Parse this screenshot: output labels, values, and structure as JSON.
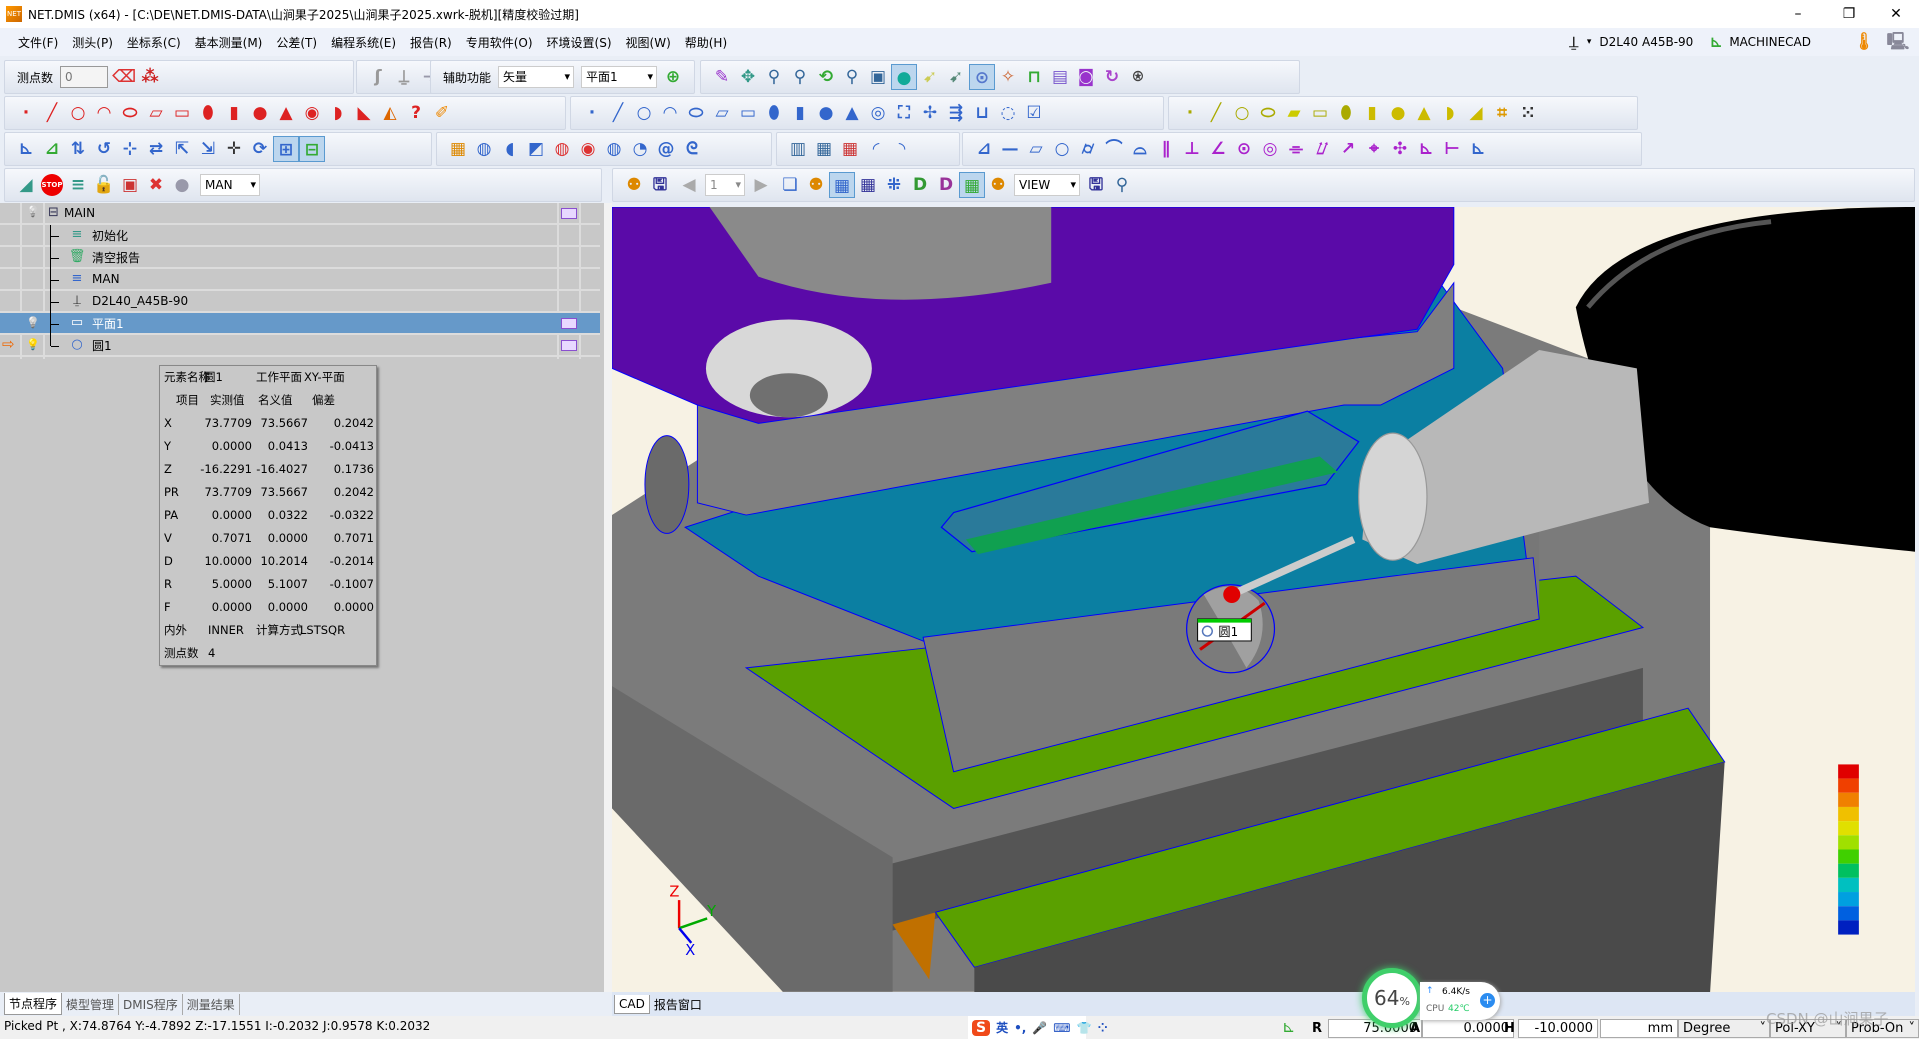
{
  "window": {
    "title": "NET.DMIS (x64) - [C:\\DE\\NET.DMIS-DATA\\山涧果子2025\\山涧果子2025.xwrk-脱机][精度校验过期]",
    "logo_text": "NET",
    "controls": {
      "minimize": "–",
      "restore": "❐",
      "close": "✕"
    }
  },
  "menu": [
    "文件(F)",
    "测头(P)",
    "坐标系(C)",
    "基本测量(M)",
    "公差(T)",
    "编程系统(E)",
    "报告(R)",
    "专用软件(O)",
    "环境设置(S)",
    "视图(W)",
    "帮助(H)"
  ],
  "menu_right": {
    "probe": "D2L40  A45B-90",
    "machine": "MACHINECAD"
  },
  "toolbar1": {
    "points_label": "测点数",
    "points_value": "0",
    "aux_label": "辅助功能",
    "vector_select": "矢量",
    "plane_select": "平面1",
    "icons_a": [
      {
        "n": "eraser-icon",
        "g": "⌫",
        "c": "#d33"
      },
      {
        "n": "erase-all-icon",
        "g": "⁂",
        "c": "#c22"
      }
    ],
    "icons_b": [
      {
        "n": "run-icon",
        "g": "ʃ",
        "c": "#999"
      },
      {
        "n": "joystick-icon",
        "g": "⍊",
        "c": "#999"
      },
      {
        "n": "arrow-right-icon",
        "g": "➔",
        "c": "#99a"
      },
      {
        "n": "xyz-plane-icon",
        "g": "◇",
        "c": "#36c"
      },
      {
        "n": "report-icon",
        "g": "▤",
        "c": "#557"
      },
      {
        "n": "home-icon",
        "g": "⌂",
        "c": "#e80"
      },
      {
        "n": "warning-icon",
        "g": "⚠",
        "c": "#cc0"
      }
    ],
    "icons_c": [
      {
        "n": "lock-plane-icon",
        "g": "⊕",
        "c": "#3a3"
      }
    ],
    "icons_d": [
      {
        "n": "clean-icon",
        "g": "✎",
        "c": "#93c"
      },
      {
        "n": "move-icon",
        "g": "✥",
        "c": "#398"
      },
      {
        "n": "zoom-window-icon",
        "g": "⚲",
        "c": "#369"
      },
      {
        "n": "zoom-plus-icon",
        "g": "⚲",
        "c": "#369"
      },
      {
        "n": "rotate-icon",
        "g": "⟲",
        "c": "#3a3"
      },
      {
        "n": "zoom-in-icon",
        "g": "⚲",
        "c": "#369"
      },
      {
        "n": "cube-view-icon",
        "g": "▣",
        "c": "#369"
      },
      {
        "n": "shade-icon",
        "g": "●",
        "c": "#1a9",
        "on": true
      },
      {
        "n": "select-icon",
        "g": "➹",
        "c": "#cc5"
      },
      {
        "n": "pick-icon",
        "g": "➹",
        "c": "#587"
      },
      {
        "n": "mouse-icon",
        "g": "⊙",
        "c": "#57c",
        "on": true
      },
      {
        "n": "spark-icon",
        "g": "✧",
        "c": "#c63"
      },
      {
        "n": "frame-icon",
        "g": "⊓",
        "c": "#3a3"
      },
      {
        "n": "list-icon",
        "g": "▤",
        "c": "#75c"
      },
      {
        "n": "camera-icon",
        "g": "◙",
        "c": "#93c"
      },
      {
        "n": "refresh-icon",
        "g": "↻",
        "c": "#a4c"
      },
      {
        "n": "probe-on-icon",
        "g": "⍟",
        "c": "#444"
      }
    ]
  },
  "toolbar2": {
    "icons_a": [
      {
        "n": "point-icon",
        "g": "·",
        "c": "#d22"
      },
      {
        "n": "line-icon",
        "g": "╱",
        "c": "#d22"
      },
      {
        "n": "circle-icon",
        "g": "○",
        "c": "#d22"
      },
      {
        "n": "arc-icon",
        "g": "◠",
        "c": "#d22"
      },
      {
        "n": "ellipse-icon",
        "g": "⬭",
        "c": "#d22"
      },
      {
        "n": "slot-icon",
        "g": "▱",
        "c": "#d22"
      },
      {
        "n": "rectangle-icon",
        "g": "▭",
        "c": "#d22"
      },
      {
        "n": "rounded-slot-icon",
        "g": "⬮",
        "c": "#d22"
      },
      {
        "n": "cylinder-icon",
        "g": "▮",
        "c": "#d22"
      },
      {
        "n": "sphere-icon",
        "g": "●",
        "c": "#d22"
      },
      {
        "n": "cone-icon",
        "g": "▲",
        "c": "#d22"
      },
      {
        "n": "torus-icon",
        "g": "◉",
        "c": "#d22"
      },
      {
        "n": "curve-icon",
        "g": "◗",
        "c": "#d22"
      },
      {
        "n": "edge-icon",
        "g": "◣",
        "c": "#d22"
      },
      {
        "n": "angle-icon",
        "g": "◭",
        "c": "#d60"
      },
      {
        "n": "help-icon",
        "g": "?",
        "c": "#d22"
      },
      {
        "n": "path-icon",
        "g": "✐",
        "c": "#e80"
      }
    ],
    "icons_b": [
      {
        "n": "point-blue-icon",
        "g": "·",
        "c": "#36c"
      },
      {
        "n": "line-blue-icon",
        "g": "╱",
        "c": "#36c"
      },
      {
        "n": "circle-blue-icon",
        "g": "○",
        "c": "#36c"
      },
      {
        "n": "arc-blue-icon",
        "g": "◠",
        "c": "#36c"
      },
      {
        "n": "ellipse-blue-icon",
        "g": "⬭",
        "c": "#36c"
      },
      {
        "n": "plane-blue-icon",
        "g": "▱",
        "c": "#36c"
      },
      {
        "n": "rect-blue-icon",
        "g": "▭",
        "c": "#36c"
      },
      {
        "n": "slot-blue-icon",
        "g": "⬮",
        "c": "#36c"
      },
      {
        "n": "cylinder-blue-icon",
        "g": "▮",
        "c": "#36c"
      },
      {
        "n": "sphere-blue-icon",
        "g": "●",
        "c": "#36c"
      },
      {
        "n": "cone-blue-icon",
        "g": "▲",
        "c": "#36c"
      },
      {
        "n": "torus-blue-icon",
        "g": "◎",
        "c": "#36c"
      },
      {
        "n": "box-blue-icon",
        "g": "⛶",
        "c": "#36c"
      },
      {
        "n": "tools-icon",
        "g": "✢",
        "c": "#36c"
      },
      {
        "n": "arrows-icon",
        "g": "⇶",
        "c": "#36c"
      },
      {
        "n": "corner-icon",
        "g": "⊔",
        "c": "#36c"
      },
      {
        "n": "dashed-circle-icon",
        "g": "◌",
        "c": "#36c"
      },
      {
        "n": "check-icon",
        "g": "☑",
        "c": "#36c"
      }
    ],
    "icons_c": [
      {
        "n": "point-yellow-icon",
        "g": "·",
        "c": "#aa0"
      },
      {
        "n": "line-yellow-icon",
        "g": "╱",
        "c": "#aa0"
      },
      {
        "n": "circle-yellow-icon",
        "g": "○",
        "c": "#aa0"
      },
      {
        "n": "ellipse-yellow-icon",
        "g": "⬭",
        "c": "#aa0"
      },
      {
        "n": "plane-yellow-icon",
        "g": "▰",
        "c": "#cc0"
      },
      {
        "n": "rect-yellow-icon",
        "g": "▭",
        "c": "#aa0"
      },
      {
        "n": "slot-yellow-icon",
        "g": "⬮",
        "c": "#aa0"
      },
      {
        "n": "cylinder-yellow-icon",
        "g": "▮",
        "c": "#cb0"
      },
      {
        "n": "sphere-yellow-icon",
        "g": "●",
        "c": "#cb0"
      },
      {
        "n": "cone-yellow-icon",
        "g": "▲",
        "c": "#cb0"
      },
      {
        "n": "curve-yellow-icon",
        "g": "◗",
        "c": "#cb0"
      },
      {
        "n": "surface-yellow-icon",
        "g": "◢",
        "c": "#cb0"
      },
      {
        "n": "grid-yellow-icon",
        "g": "⌗",
        "c": "#d90"
      },
      {
        "n": "dots-icon",
        "g": "⁙",
        "c": "#333"
      }
    ]
  },
  "toolbar3": {
    "icons_a": [
      {
        "n": "init-coord-icon",
        "g": "⊾",
        "c": "#36c"
      },
      {
        "n": "align-icon",
        "g": "⊿",
        "c": "#3a3"
      },
      {
        "n": "coord-321-icon",
        "g": "⇅",
        "c": "#36c"
      },
      {
        "n": "rotate-coord-icon",
        "g": "↺",
        "c": "#36c"
      },
      {
        "n": "rps-icon",
        "g": "⊹",
        "c": "#36c"
      },
      {
        "n": "best-fit-icon",
        "g": "⇄",
        "c": "#36c"
      },
      {
        "n": "translate-icon",
        "g": "⇱",
        "c": "#36c"
      },
      {
        "n": "transform-icon",
        "g": "⇲",
        "c": "#36c"
      },
      {
        "n": "axis-icon",
        "g": "✛",
        "c": "#333"
      },
      {
        "n": "rotate-axis-icon",
        "g": "⟳",
        "c": "#36c"
      },
      {
        "n": "coord-save-icon",
        "g": "⊞",
        "c": "#36c",
        "on": true
      },
      {
        "n": "coord-recall-icon",
        "g": "⊟",
        "c": "#3a3",
        "on": true
      }
    ],
    "icons_b": [
      {
        "n": "construct-icon",
        "g": "▦",
        "c": "#d80"
      },
      {
        "n": "cylinder-section-icon",
        "g": "◍",
        "c": "#36c"
      },
      {
        "n": "half-cyl-icon",
        "g": "◖",
        "c": "#36c"
      },
      {
        "n": "cut-icon",
        "g": "◩",
        "c": "#36c"
      },
      {
        "n": "cyl-red-icon",
        "g": "◍",
        "c": "#d33"
      },
      {
        "n": "disk-icon",
        "g": "◉",
        "c": "#d33"
      },
      {
        "n": "stack-icon",
        "g": "◍",
        "c": "#36c"
      },
      {
        "n": "fan-icon",
        "g": "◔",
        "c": "#36c"
      },
      {
        "n": "spiral-icon",
        "g": "@",
        "c": "#36c"
      },
      {
        "n": "swirl-icon",
        "g": "ᘓ",
        "c": "#36c"
      }
    ],
    "icons_c": [
      {
        "n": "report-table-icon",
        "g": "▥",
        "c": "#369"
      },
      {
        "n": "grid-table-icon",
        "g": "▦",
        "c": "#369"
      },
      {
        "n": "grid-red-icon",
        "g": "▦",
        "c": "#c33"
      },
      {
        "n": "curve-report-icon",
        "g": "◜",
        "c": "#36c"
      },
      {
        "n": "curve-edit-icon",
        "g": "◝",
        "c": "#36c"
      }
    ],
    "icons_d": [
      {
        "n": "dimension-icon",
        "g": "⊿",
        "c": "#36c"
      },
      {
        "n": "straightness-icon",
        "g": "—",
        "c": "#36c"
      },
      {
        "n": "flatness-icon",
        "g": "▱",
        "c": "#36c"
      },
      {
        "n": "roundness-icon",
        "g": "○",
        "c": "#36c"
      },
      {
        "n": "cylindricity-icon",
        "g": "⌭",
        "c": "#36c"
      },
      {
        "n": "line-profile-icon",
        "g": "⌒",
        "c": "#36c"
      },
      {
        "n": "surface-profile-icon",
        "g": "⌓",
        "c": "#36c"
      },
      {
        "n": "parallelism-icon",
        "g": "∥",
        "c": "#a2c"
      },
      {
        "n": "perpendicularity-icon",
        "g": "⊥",
        "c": "#a2c"
      },
      {
        "n": "angularity-icon",
        "g": "∠",
        "c": "#a2c"
      },
      {
        "n": "concentricity-icon",
        "g": "⊙",
        "c": "#a2c"
      },
      {
        "n": "coaxiality-icon",
        "g": "◎",
        "c": "#a2c"
      },
      {
        "n": "symmetry-icon",
        "g": "⌯",
        "c": "#a2c"
      },
      {
        "n": "total-runout-icon",
        "g": "⌰",
        "c": "#a2c"
      },
      {
        "n": "runout-icon",
        "g": "↗",
        "c": "#a2c"
      },
      {
        "n": "position-icon",
        "g": "⌖",
        "c": "#a2c"
      },
      {
        "n": "position-multi-icon",
        "g": "✣",
        "c": "#a2c"
      },
      {
        "n": "distance-icon",
        "g": "⊾",
        "c": "#a2c"
      },
      {
        "n": "width-icon",
        "g": "⊢",
        "c": "#a2c"
      },
      {
        "n": "chart-icon",
        "g": "⊾",
        "c": "#36c"
      }
    ]
  },
  "tree_toolbar": {
    "mode_select": "MAN",
    "icons": [
      {
        "n": "curve-run-icon",
        "g": "◢",
        "c": "#398"
      },
      {
        "n": "stop-icon",
        "g": "STOP",
        "c": "#fff"
      },
      {
        "n": "program-icon",
        "g": "≡",
        "c": "#398"
      },
      {
        "n": "unlock-icon",
        "g": "🔓",
        "c": "#eb0"
      },
      {
        "n": "window-ball-icon",
        "g": "▣",
        "c": "#c33"
      },
      {
        "n": "delete-balls-icon",
        "g": "✖",
        "c": "#d33"
      },
      {
        "n": "ball-down-icon",
        "g": "●",
        "c": "#99a"
      }
    ]
  },
  "viewport_toolbar": {
    "page_select": "1",
    "view_select": "VIEW",
    "icons_a": [
      {
        "n": "probe-view-icon",
        "g": "⚉",
        "c": "#d80"
      },
      {
        "n": "save-doc-icon",
        "g": "🖫",
        "c": "#339"
      }
    ],
    "icons_b": [
      {
        "n": "new-page-icon",
        "g": "❏",
        "c": "#36c"
      },
      {
        "n": "probe-page-icon",
        "g": "⚉",
        "c": "#d80"
      },
      {
        "n": "table-view-icon",
        "g": "▦",
        "c": "#36c",
        "on": true
      },
      {
        "n": "table-pick-icon",
        "g": "▦",
        "c": "#339"
      },
      {
        "n": "layout-icon",
        "g": "⁜",
        "c": "#36c"
      },
      {
        "n": "dmis-icon",
        "g": "D",
        "c": "#393"
      },
      {
        "n": "dmis-pick-icon",
        "g": "D",
        "c": "#939"
      },
      {
        "n": "green-table-icon",
        "g": "▦",
        "c": "#3a3",
        "on": true
      },
      {
        "n": "probe-table-icon",
        "g": "⚉",
        "c": "#d80"
      }
    ],
    "icons_c": [
      {
        "n": "save-view-icon",
        "g": "🖫",
        "c": "#339"
      },
      {
        "n": "find-icon",
        "g": "⚲",
        "c": "#369"
      }
    ]
  },
  "tree": {
    "rows": [
      {
        "label": "MAIN",
        "icon": "collapse-icon",
        "glyph": "⊟",
        "color": "#335"
      },
      {
        "label": "初始化",
        "icon": "init-icon",
        "glyph": "≡",
        "color": "#398"
      },
      {
        "label": "清空报告",
        "icon": "clear-report-icon",
        "glyph": "🗑",
        "color": "#3a6"
      },
      {
        "label": "MAN",
        "icon": "mode-icon",
        "glyph": "≡",
        "color": "#36c"
      },
      {
        "label": "D2L40_A45B-90",
        "icon": "probe-icon",
        "glyph": "⍊",
        "color": "#222"
      },
      {
        "label": "平面1",
        "icon": "plane-icon",
        "glyph": "▭",
        "color": "#fff"
      },
      {
        "label": "圆1",
        "icon": "circle-icon",
        "glyph": "○",
        "color": "#36c"
      }
    ]
  },
  "info": {
    "header": [
      "元素名称",
      "圆1",
      "工作平面",
      "XY-平面"
    ],
    "columns": [
      "项目",
      "实测值",
      "名义值",
      "偏差"
    ],
    "rows": [
      [
        "X",
        "73.7709",
        "73.5667",
        "0.2042"
      ],
      [
        "Y",
        "0.0000",
        "0.0413",
        "-0.0413"
      ],
      [
        "Z",
        "-16.2291",
        "-16.4027",
        "0.1736"
      ],
      [
        "PR",
        "73.7709",
        "73.5667",
        "0.2042"
      ],
      [
        "PA",
        "0.0000",
        "0.0322",
        "-0.0322"
      ],
      [
        "V",
        "0.7071",
        "0.0000",
        "0.7071"
      ],
      [
        "D",
        "10.0000",
        "10.2014",
        "-0.2014"
      ],
      [
        "R",
        "5.0000",
        "5.1007",
        "-0.1007"
      ],
      [
        "F",
        "0.0000",
        "0.0000",
        "0.0000"
      ]
    ],
    "inout": [
      "内外",
      "INNER",
      "计算方式",
      "LSTSQR"
    ],
    "count": [
      "测点数",
      "4"
    ]
  },
  "viewport": {
    "feature_label": "圆1",
    "axis": {
      "z": "Z",
      "y": "Y",
      "x": "X"
    },
    "colorbar": [
      "#e00000",
      "#f04000",
      "#f08000",
      "#f0c000",
      "#e0e000",
      "#a0e000",
      "#40d000",
      "#00c060",
      "#00c0c0",
      "#00a0e0",
      "#0060e0",
      "#0020c0"
    ]
  },
  "bottom_tabs": {
    "left": [
      "节点程序",
      "模型管理",
      "DMIS程序",
      "测量结果"
    ],
    "right": [
      "CAD",
      "报告窗口"
    ]
  },
  "status": {
    "picked": "Picked Pt , X:74.8764 Y:-4.7892 Z:-17.1551  I:-0.2032  J:0.9578  K:0.2032",
    "r_label": "R",
    "r_value": "75.0000",
    "a_label": "A",
    "a_value": "0.0000",
    "h_label": "H",
    "h_value": "-10.0000",
    "unit": "mm",
    "angle_unit": "Degree",
    "plane": "Pol-XY",
    "probe_mode": "Prob-On"
  },
  "overlay": {
    "ime": [
      "S",
      "英",
      "•,",
      "🎤",
      "⌨",
      "👕",
      "⁘"
    ],
    "cpu_percent": "64",
    "percent_sign": "%",
    "net_speed": "6.4K/s",
    "cpu_label": "CPU",
    "cpu_temp": "42℃",
    "watermark": "CSDN @山涧果子"
  }
}
